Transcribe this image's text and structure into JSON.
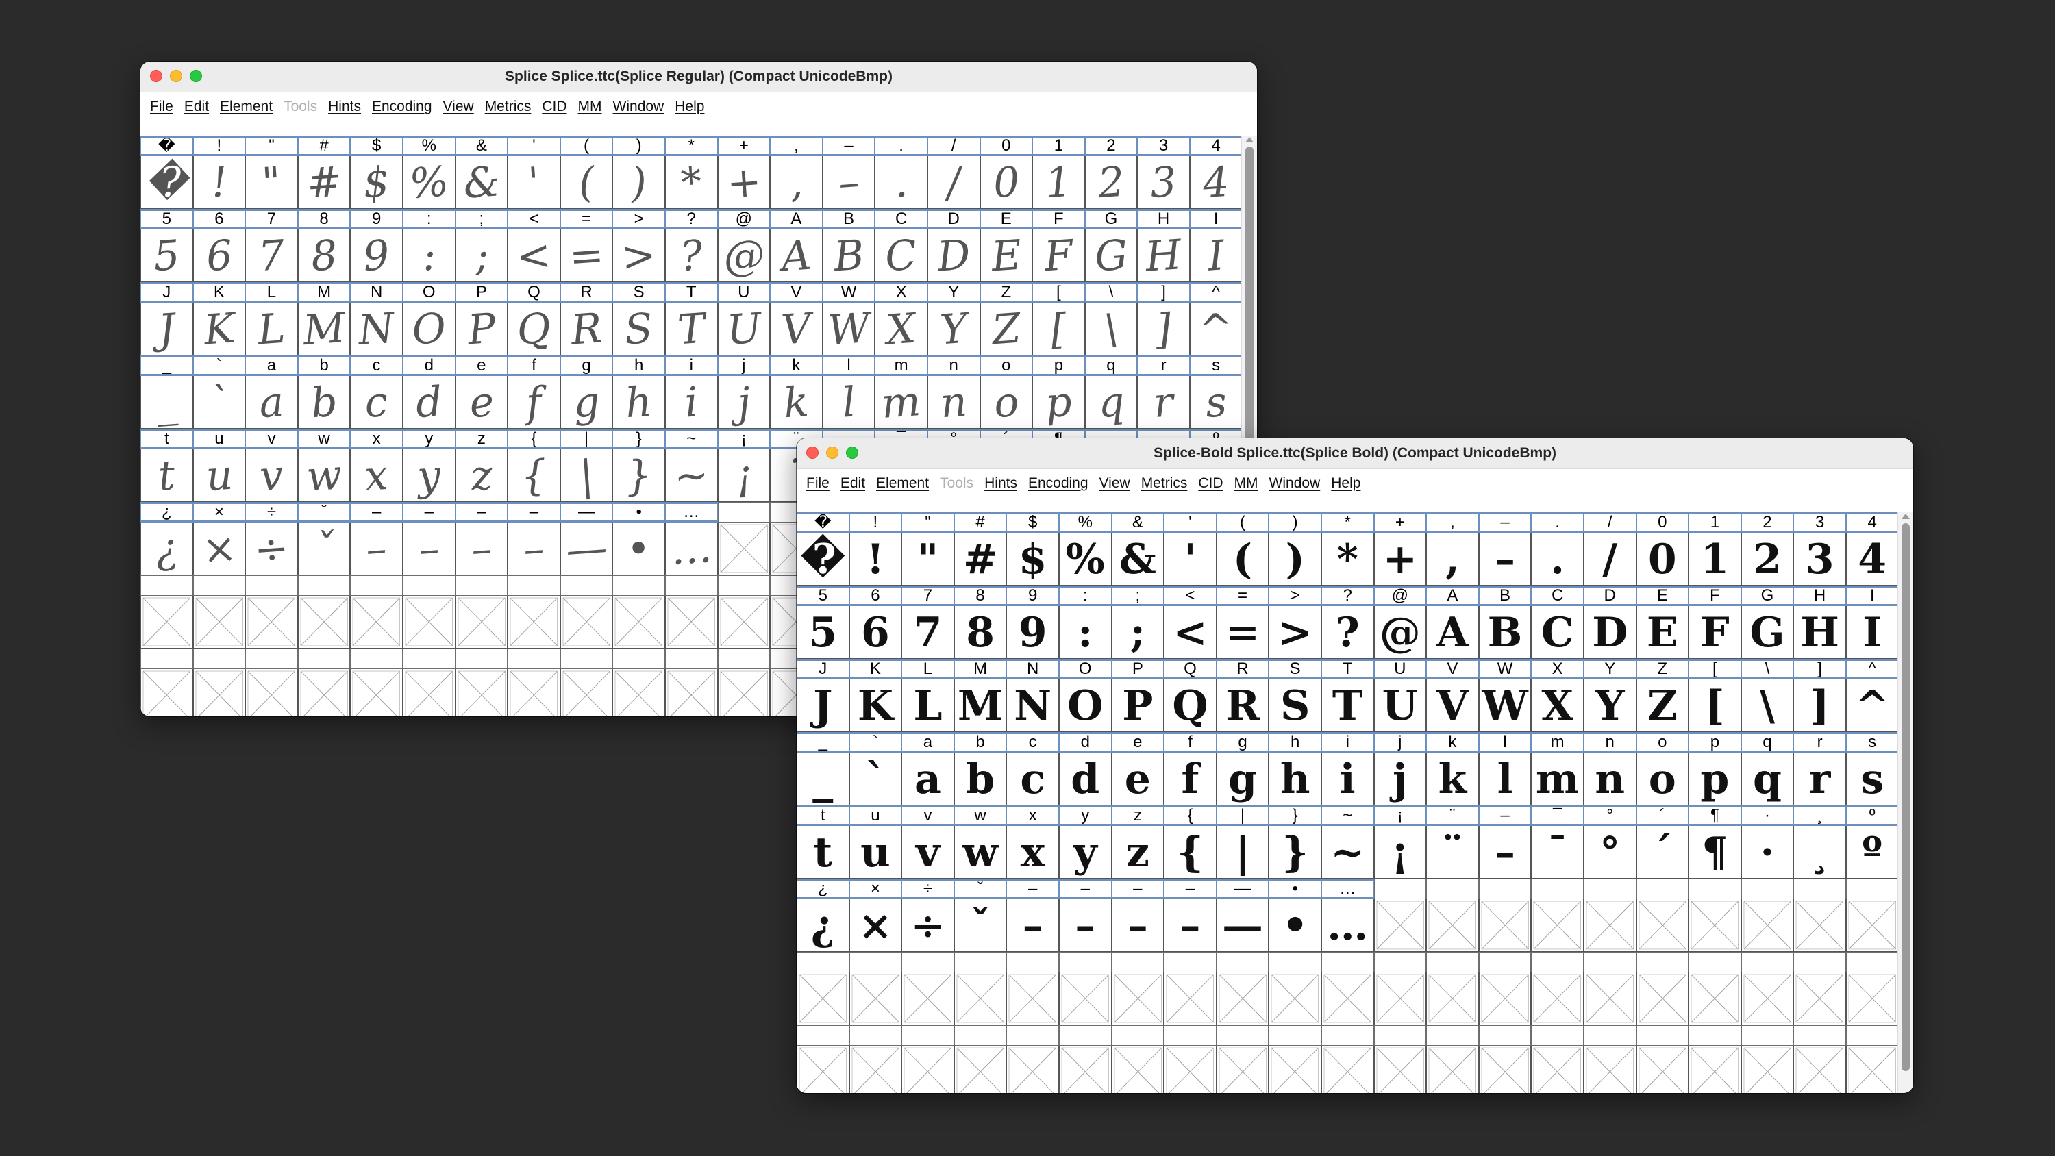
{
  "windows": [
    {
      "title": "Splice  Splice.ttc(Splice Regular) (Compact UnicodeBmp)",
      "menus": [
        {
          "label": "File",
          "enabled": true
        },
        {
          "label": "Edit",
          "enabled": true
        },
        {
          "label": "Element",
          "enabled": true
        },
        {
          "label": "Tools",
          "enabled": false
        },
        {
          "label": "Hints",
          "enabled": true
        },
        {
          "label": "Encoding",
          "enabled": true
        },
        {
          "label": "View",
          "enabled": true
        },
        {
          "label": "Metrics",
          "enabled": true
        },
        {
          "label": "CID",
          "enabled": true
        },
        {
          "label": "MM",
          "enabled": true
        },
        {
          "label": "Window",
          "enabled": true
        },
        {
          "label": "Help",
          "enabled": true
        }
      ]
    },
    {
      "title": "Splice-Bold  Splice.ttc(Splice Bold) (Compact UnicodeBmp)",
      "menus": [
        {
          "label": "File",
          "enabled": true
        },
        {
          "label": "Edit",
          "enabled": true
        },
        {
          "label": "Element",
          "enabled": true
        },
        {
          "label": "Tools",
          "enabled": false
        },
        {
          "label": "Hints",
          "enabled": true
        },
        {
          "label": "Encoding",
          "enabled": true
        },
        {
          "label": "View",
          "enabled": true
        },
        {
          "label": "Metrics",
          "enabled": true
        },
        {
          "label": "CID",
          "enabled": true
        },
        {
          "label": "MM",
          "enabled": true
        },
        {
          "label": "Window",
          "enabled": true
        },
        {
          "label": "Help",
          "enabled": true
        }
      ]
    }
  ],
  "glyph_grid": {
    "columns": 21,
    "rows": [
      [
        "�",
        "!",
        "\"",
        "#",
        "$",
        "%",
        "&",
        "'",
        "(",
        ")",
        "*",
        "+",
        ",",
        "–",
        ".",
        "/",
        "0",
        "1",
        "2",
        "3",
        "4"
      ],
      [
        "5",
        "6",
        "7",
        "8",
        "9",
        ":",
        ";",
        "<",
        "=",
        ">",
        "?",
        "@",
        "A",
        "B",
        "C",
        "D",
        "E",
        "F",
        "G",
        "H",
        "I"
      ],
      [
        "J",
        "K",
        "L",
        "M",
        "N",
        "O",
        "P",
        "Q",
        "R",
        "S",
        "T",
        "U",
        "V",
        "W",
        "X",
        "Y",
        "Z",
        "[",
        "\\",
        "]",
        "^"
      ],
      [
        "_",
        "`",
        "a",
        "b",
        "c",
        "d",
        "e",
        "f",
        "g",
        "h",
        "i",
        "j",
        "k",
        "l",
        "m",
        "n",
        "o",
        "p",
        "q",
        "r",
        "s"
      ],
      [
        "t",
        "u",
        "v",
        "w",
        "x",
        "y",
        "z",
        "{",
        "|",
        "}",
        "~",
        "¡",
        "¨",
        "–",
        "¯",
        "°",
        "´",
        "¶",
        "·",
        "¸",
        "º"
      ],
      [
        "¿",
        "×",
        "÷",
        "ˇ",
        "–",
        "–",
        "–",
        "–",
        "—",
        "•",
        "…",
        "",
        "",
        "",
        "",
        "",
        "",
        "",
        "",
        "",
        ""
      ],
      [
        "",
        "",
        "",
        "",
        "",
        "",
        "",
        "",
        "",
        "",
        "",
        "",
        "",
        "",
        "",
        "",
        "",
        "",
        "",
        "",
        ""
      ],
      [
        "",
        "",
        "",
        "",
        "",
        "",
        "",
        "",
        "",
        "",
        "",
        "",
        "",
        "",
        "",
        "",
        "",
        "",
        "",
        "",
        ""
      ]
    ]
  }
}
